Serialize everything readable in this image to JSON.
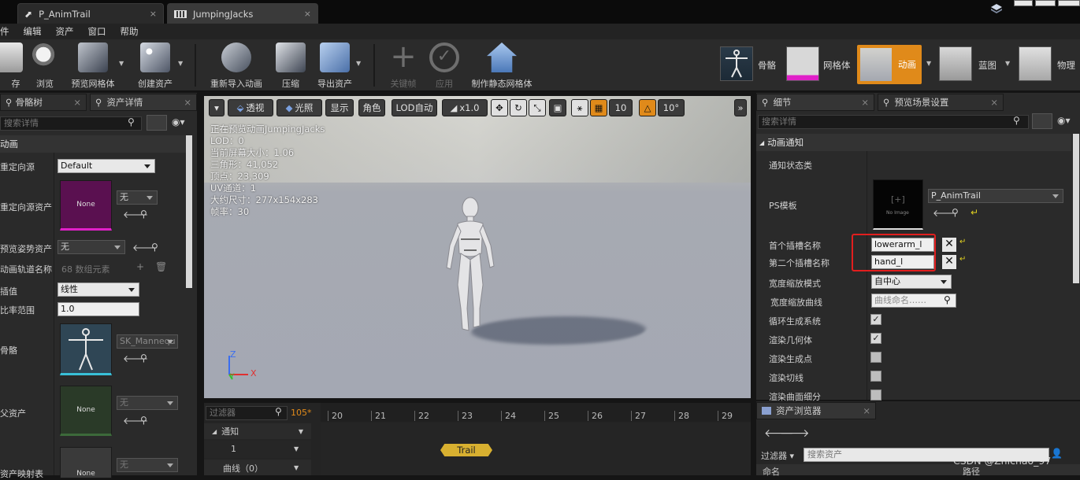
{
  "tabs": {
    "doc1": "P_AnimTrail",
    "doc2": "JumpingJacks",
    "close": "×"
  },
  "menu": [
    "件",
    "编辑",
    "资产",
    "窗口",
    "帮助"
  ],
  "toolbar": {
    "save": "保存",
    "save_visible": "存",
    "browse": "浏览",
    "preview_mesh": "预览网格体",
    "create_asset": "创建资产",
    "reimport": "重新导入动画",
    "compress": "压缩",
    "export": "导出资产",
    "keyframe": "关键帧",
    "apply": "应用",
    "make_static": "制作静态网格体",
    "modes": {
      "skeleton": "骨骼",
      "mesh": "网格体",
      "animation": "动画",
      "blueprint": "蓝图",
      "physics": "物理"
    }
  },
  "left_panel": {
    "tab1": "骨骼树",
    "tab2": "资产详情",
    "search_placeholder": "搜索详情",
    "section": "动画",
    "rows": {
      "retarget_source": "重定向源",
      "retarget_source_value": "Default",
      "retarget_source_asset": "重定向源资产",
      "retarget_none": "None",
      "retarget_combo": "无",
      "preview_pose": "预览姿势资产",
      "preview_pose_value": "无",
      "anim_track": "动画轨道名称",
      "anim_track_value": "68 数组元素",
      "interp": "插值",
      "interp_value": "线性",
      "rate": "比率范围",
      "rate_value": "1.0",
      "skeleton": "骨骼",
      "skeleton_value": "SK_Mannequ",
      "parent": "父资产",
      "parent_none": "None",
      "parent_combo": "无",
      "asset_mapping": "资产映射表",
      "asset_mapping_none": "None",
      "asset_mapping_combo": "无"
    }
  },
  "viewport": {
    "perspective": "透视",
    "lit": "光照",
    "show": "显示",
    "character": "角色",
    "lod_auto": "LOD自动",
    "speed": "x1.0",
    "grid_value": "10",
    "angle_value": "10°",
    "stats": [
      "正在预览动画JumpingJacks",
      "LOD：0",
      "当前屏幕大小：1.06",
      "三角形：41,052",
      "顶点：23,309",
      "UV通道：1",
      "大约尺寸：277x154x283",
      "帧率：30"
    ],
    "axis_z": "Z",
    "axis_x": "X",
    "axis_y": "Y"
  },
  "timeline": {
    "filter_placeholder": "过滤器",
    "frame": "105*",
    "ticks": [
      "20",
      "21",
      "22",
      "23",
      "24",
      "25",
      "26",
      "27",
      "28",
      "29"
    ],
    "notify": "通知",
    "track1": "1",
    "curves": "曲线（0）",
    "trail": "Trail"
  },
  "right_panel": {
    "tab1": "细节",
    "tab2": "预览场景设置",
    "search_placeholder": "搜索详情",
    "section": "动画通知",
    "rows": {
      "notify_state_class": "通知状态类",
      "ps_template": "PS模板",
      "ps_value": "P_AnimTrail",
      "no_image": "No Image",
      "first_socket": "首个插槽名称",
      "first_socket_value": "lowerarm_l",
      "second_socket": "第二个插槽名称",
      "second_socket_value": "hand_l",
      "width_scale_mode": "宽度缩放模式",
      "width_scale_mode_value": "自中心",
      "width_scale_curve": "宽度缩放曲线",
      "width_scale_curve_placeholder": "曲线命名……",
      "recycle": "循环生成系统",
      "render_geometry": "渲染几何体",
      "render_spawn": "渲染生成点",
      "render_tangent": "渲染切线",
      "render_tessellation": "渲染曲面细分"
    }
  },
  "asset_browser": {
    "tab": "资产浏览器",
    "filter": "过滤器",
    "search_placeholder": "搜索资产",
    "col_name": "命名",
    "col_path": "路径",
    "watermark": "CSDN @Zhichao_97"
  }
}
